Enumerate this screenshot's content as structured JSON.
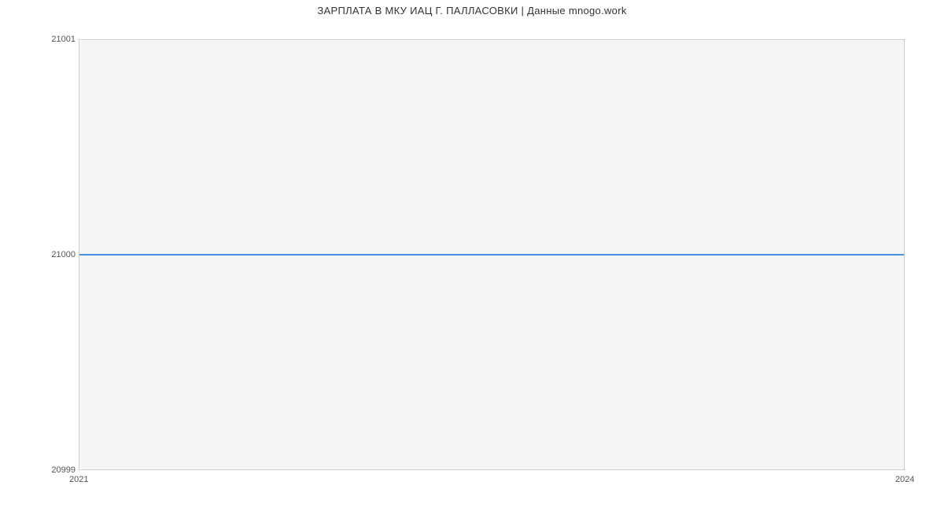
{
  "chart_data": {
    "type": "line",
    "title": "ЗАРПЛАТА В МКУ ИАЦ Г. ПАЛЛАСОВКИ | Данные mnogo.work",
    "xlabel": "",
    "ylabel": "",
    "x": [
      2021,
      2024
    ],
    "values": [
      21000,
      21000
    ],
    "xlim": [
      2021,
      2024
    ],
    "ylim": [
      20999,
      21001
    ],
    "y_ticks": [
      20999,
      21000,
      21001
    ],
    "x_ticks": [
      2021,
      2024
    ],
    "line_color": "#4a90e2",
    "background": "#f5f5f5"
  }
}
